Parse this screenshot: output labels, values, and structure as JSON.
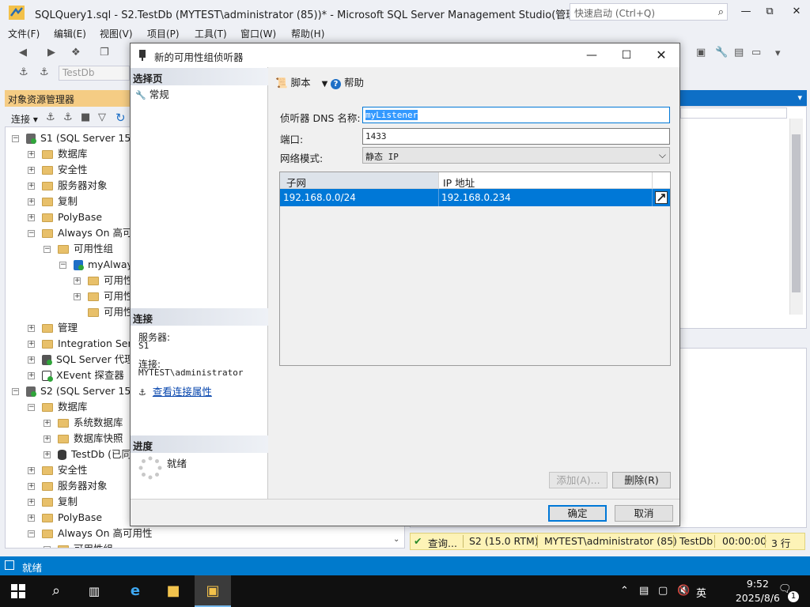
{
  "window": {
    "title": "SQLQuery1.sql - S2.TestDb (MYTEST\\administrator (85))* - Microsoft SQL Server Management Studio(管理员)",
    "quick_launch_placeholder": "快速启动 (Ctrl+Q)"
  },
  "menu": [
    "文件(F)",
    "编辑(E)",
    "视图(V)",
    "项目(P)",
    "工具(T)",
    "窗口(W)",
    "帮助(H)"
  ],
  "toolbar": {
    "database_combo": "TestDb"
  },
  "object_explorer": {
    "title": "对象资源管理器",
    "connect_label": "连接",
    "tree": [
      {
        "label": "S1 (SQL Server 15.0",
        "kind": "server",
        "level": 0,
        "state": "expanded"
      },
      {
        "label": "数据库",
        "kind": "folder",
        "level": 1,
        "state": "collapsed"
      },
      {
        "label": "安全性",
        "kind": "folder",
        "level": 1,
        "state": "collapsed"
      },
      {
        "label": "服务器对象",
        "kind": "folder",
        "level": 1,
        "state": "collapsed"
      },
      {
        "label": "复制",
        "kind": "folder",
        "level": 1,
        "state": "collapsed"
      },
      {
        "label": "PolyBase",
        "kind": "folder",
        "level": 1,
        "state": "collapsed"
      },
      {
        "label": "Always On 高可用",
        "kind": "folder",
        "level": 1,
        "state": "expanded"
      },
      {
        "label": "可用性组",
        "kind": "folder",
        "level": 2,
        "state": "expanded"
      },
      {
        "label": "myAlways",
        "kind": "ag",
        "level": 3,
        "state": "expanded"
      },
      {
        "label": "可用性",
        "kind": "folder",
        "level": 4,
        "state": "collapsed"
      },
      {
        "label": "可用性",
        "kind": "folder",
        "level": 4,
        "state": "collapsed"
      },
      {
        "label": "可用性",
        "kind": "folder",
        "level": 4,
        "state": "none"
      },
      {
        "label": "管理",
        "kind": "folder",
        "level": 1,
        "state": "collapsed"
      },
      {
        "label": "Integration Serv",
        "kind": "folder",
        "level": 1,
        "state": "collapsed"
      },
      {
        "label": "SQL Server 代理",
        "kind": "agent",
        "level": 1,
        "state": "collapsed"
      },
      {
        "label": "XEvent 探查器",
        "kind": "xevent",
        "level": 1,
        "state": "collapsed"
      },
      {
        "label": "S2 (SQL Server 15.0",
        "kind": "server",
        "level": 0,
        "state": "expanded"
      },
      {
        "label": "数据库",
        "kind": "folder",
        "level": 1,
        "state": "expanded"
      },
      {
        "label": "系统数据库",
        "kind": "folder",
        "level": 2,
        "state": "collapsed"
      },
      {
        "label": "数据库快照",
        "kind": "folder",
        "level": 2,
        "state": "collapsed"
      },
      {
        "label": "TestDb (已同",
        "kind": "db",
        "level": 2,
        "state": "collapsed"
      },
      {
        "label": "安全性",
        "kind": "folder",
        "level": 1,
        "state": "collapsed"
      },
      {
        "label": "服务器对象",
        "kind": "folder",
        "level": 1,
        "state": "collapsed"
      },
      {
        "label": "复制",
        "kind": "folder",
        "level": 1,
        "state": "collapsed"
      },
      {
        "label": "PolyBase",
        "kind": "folder",
        "level": 1,
        "state": "collapsed"
      },
      {
        "label": "Always On 高可用性",
        "kind": "folder",
        "level": 1,
        "state": "expanded"
      },
      {
        "label": "可用性组",
        "kind": "folder",
        "level": 2,
        "state": "expanded"
      }
    ]
  },
  "query_status": {
    "state": "查询...",
    "server": "S2 (15.0 RTM)",
    "user": "MYTEST\\administrator (85)",
    "database": "TestDb",
    "elapsed": "00:00:00",
    "rows": "3 行"
  },
  "status_bar": {
    "text": "就绪"
  },
  "taskbar": {
    "time": "9:52",
    "date": "2025/8/6",
    "ime": "英",
    "notifications": "1"
  },
  "dialog": {
    "title": "新的可用性组侦听器",
    "left": {
      "select_page_header": "选择页",
      "pages": [
        "常规"
      ],
      "connection_header": "连接",
      "server_label": "服务器:",
      "server_value": "S1",
      "connection_label": "连接:",
      "connection_value": "MYTEST\\administrator",
      "view_connection_link": "查看连接属性",
      "progress_header": "进度",
      "progress_status": "就绪"
    },
    "toolbar": {
      "script_label": "脚本",
      "help_label": "帮助"
    },
    "form": {
      "dns_label": "侦听器 DNS 名称:",
      "dns_value": "myListener",
      "port_label": "端口:",
      "port_value": "1433",
      "network_mode_label": "网络模式:",
      "network_mode_value": "静态 IP"
    },
    "grid": {
      "columns": [
        "子网",
        "IP 地址"
      ],
      "rows": [
        {
          "subnet": "192.168.0.0/24",
          "ip": "192.168.0.234"
        }
      ]
    },
    "buttons": {
      "add": "添加(A)...",
      "remove": "删除(R)",
      "ok": "确定",
      "cancel": "取消"
    }
  }
}
